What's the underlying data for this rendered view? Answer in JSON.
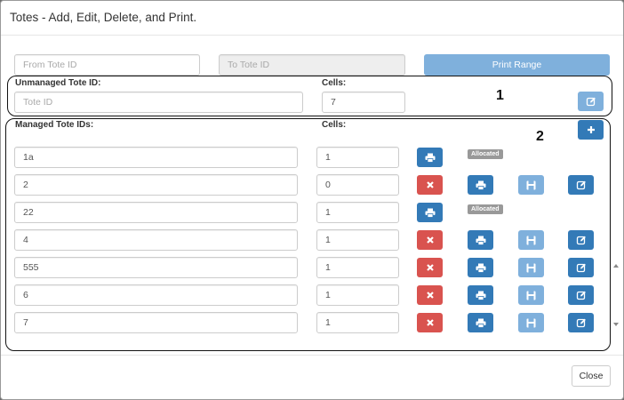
{
  "modal": {
    "title": "Totes - Add, Edit, Delete, and Print."
  },
  "range": {
    "from_placeholder": "From Tote ID",
    "to_placeholder": "To Tote ID",
    "print_label": "Print Range"
  },
  "unmanaged": {
    "label": "Unmanaged Tote ID:",
    "cells_label": "Cells:",
    "tote_placeholder": "Tote ID",
    "cells_value": "7"
  },
  "managed": {
    "label": "Managed Tote IDs:",
    "cells_label": "Cells:",
    "allocated_label": "Allocated",
    "rows": [
      {
        "tote_id": "1a",
        "cells": "1",
        "allocated": true
      },
      {
        "tote_id": "2",
        "cells": "0",
        "allocated": false
      },
      {
        "tote_id": "22",
        "cells": "1",
        "allocated": true
      },
      {
        "tote_id": "4",
        "cells": "1",
        "allocated": false
      },
      {
        "tote_id": "555",
        "cells": "1",
        "allocated": false
      },
      {
        "tote_id": "6",
        "cells": "1",
        "allocated": false
      },
      {
        "tote_id": "7",
        "cells": "1",
        "allocated": false
      }
    ]
  },
  "annotations": {
    "box1": "1",
    "box2": "2"
  },
  "footer": {
    "close_label": "Close"
  },
  "icons": {
    "print": "print-icon",
    "delete": "times-icon",
    "save": "floppy-disk-icon",
    "edit": "edit-icon",
    "add": "plus-icon"
  },
  "colors": {
    "primary": "#337ab7",
    "primary_light": "#7fb0dc",
    "danger": "#d9534f",
    "badge": "#999999"
  }
}
